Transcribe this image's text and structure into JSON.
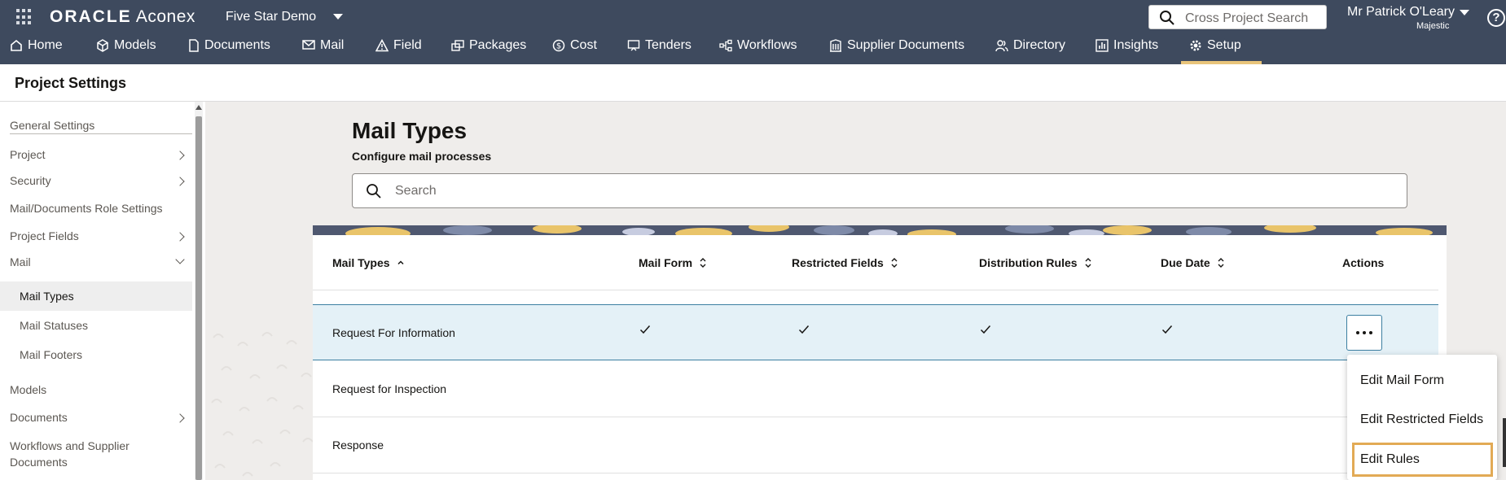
{
  "topbar": {
    "logo_brand": "ORACLE",
    "logo_product": "Aconex",
    "project": "Five Star Demo",
    "cross_search_placeholder": "Cross Project Search",
    "user_name": "Mr Patrick O'Leary",
    "user_org": "Majestic",
    "help": "?"
  },
  "nav": [
    {
      "label": "Home",
      "icon": "home-icon"
    },
    {
      "label": "Models",
      "icon": "cube-icon"
    },
    {
      "label": "Documents",
      "icon": "document-icon"
    },
    {
      "label": "Mail",
      "icon": "mail-icon"
    },
    {
      "label": "Field",
      "icon": "warning-icon"
    },
    {
      "label": "Packages",
      "icon": "packages-icon"
    },
    {
      "label": "Cost",
      "icon": "cost-icon"
    },
    {
      "label": "Tenders",
      "icon": "tenders-icon"
    },
    {
      "label": "Workflows",
      "icon": "workflow-icon"
    },
    {
      "label": "Supplier Documents",
      "icon": "supplier-icon"
    },
    {
      "label": "Directory",
      "icon": "people-icon"
    },
    {
      "label": "Insights",
      "icon": "chart-icon"
    },
    {
      "label": "Setup",
      "icon": "gear-icon",
      "active": true
    }
  ],
  "page_title": "Project Settings",
  "sidebar": {
    "general": "General Settings",
    "project": "Project",
    "security": "Security",
    "mail_doc_roles": "Mail/Documents Role Settings",
    "project_fields": "Project Fields",
    "mail": "Mail",
    "mail_types": "Mail Types",
    "mail_statuses": "Mail Statuses",
    "mail_footers": "Mail Footers",
    "models": "Models",
    "documents": "Documents",
    "workflows_line1": "Workflows and Supplier",
    "workflows_line2": "Documents"
  },
  "main": {
    "title": "Mail Types",
    "subtitle": "Configure mail processes",
    "search_placeholder": "Search",
    "columns": [
      "Mail Types",
      "Mail Form",
      "Restricted Fields",
      "Distribution Rules",
      "Due Date",
      "Actions"
    ],
    "rows": [
      {
        "name": "Request For Information",
        "mail_form": true,
        "restricted_fields": true,
        "distribution_rules": true,
        "due_date": true
      },
      {
        "name": "Request for Inspection",
        "mail_form": false,
        "restricted_fields": false,
        "distribution_rules": false,
        "due_date": false
      },
      {
        "name": "Response",
        "mail_form": false,
        "restricted_fields": false,
        "distribution_rules": false,
        "due_date": false
      }
    ],
    "menu": [
      "Edit Mail Form",
      "Edit Restricted Fields",
      "Edit Rules"
    ]
  },
  "colors": {
    "header_bg": "#3e4a5e",
    "active_tab": "#e8c47a",
    "selected_row": "#e4f1f7",
    "focus_ring": "#e2aa55"
  }
}
